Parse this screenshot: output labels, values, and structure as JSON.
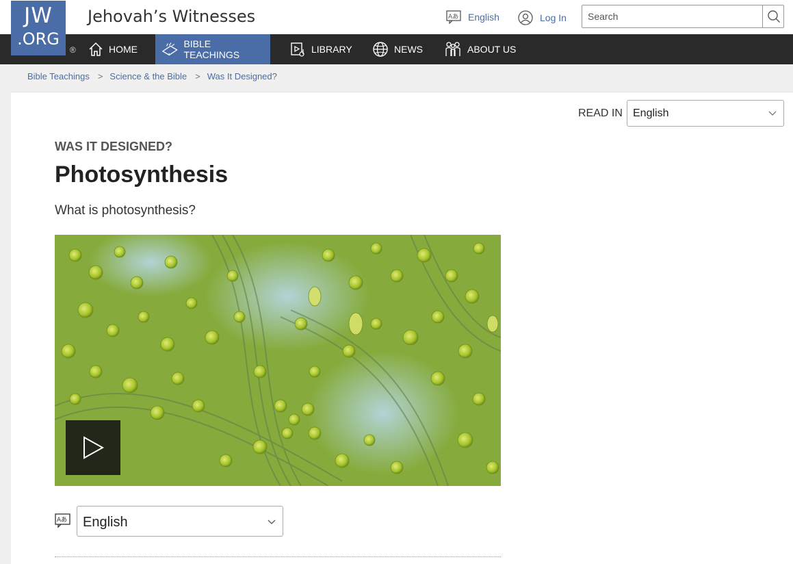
{
  "header": {
    "logo_line1": "JW",
    "logo_line2": ".ORG",
    "registered": "®",
    "site_title": "Jehovah’s Witnesses",
    "language_link": "English",
    "login_link": "Log In",
    "search_placeholder": "Search"
  },
  "nav": {
    "items": [
      {
        "label": "HOME",
        "icon": "home-icon"
      },
      {
        "label": "BIBLE TEACHINGS",
        "icon": "open-bible-icon",
        "active": true
      },
      {
        "label": "LIBRARY",
        "icon": "library-icon"
      },
      {
        "label": "NEWS",
        "icon": "globe-icon"
      },
      {
        "label": "ABOUT US",
        "icon": "people-icon"
      }
    ]
  },
  "breadcrumb": [
    "Bible Teachings",
    "Science & the Bible",
    "Was It Designed?"
  ],
  "read_in": {
    "label": "READ IN",
    "selected": "English"
  },
  "article": {
    "kicker": "WAS IT DESIGNED?",
    "title": "Photosynthesis",
    "question": "What is photosynthesis?"
  },
  "video": {
    "image": "microscope view of green algae cells",
    "play_icon": "play-icon"
  },
  "video_language": {
    "selected": "English"
  },
  "colors": {
    "brand_blue": "#4a6da7",
    "nav_bg": "#2a2a2a",
    "page_bg": "#f0f0f0"
  }
}
